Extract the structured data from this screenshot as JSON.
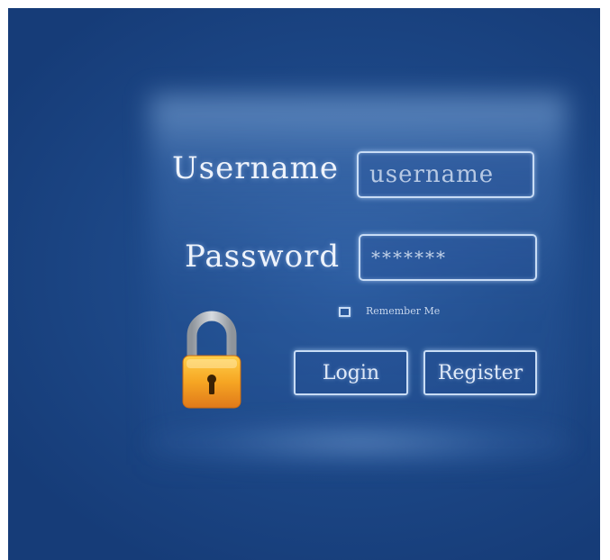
{
  "login": {
    "username_label": "Username",
    "username_value": "username",
    "password_label": "Password",
    "password_value": "*******",
    "remember_label": "Remember Me",
    "login_button": "Login",
    "register_button": "Register"
  },
  "icons": {
    "lock": "padlock-icon"
  },
  "colors": {
    "background": "#1e4a8a",
    "field_border": "#c8dcf5",
    "lock_body": "#f3a21c",
    "lock_shackle": "#a8adb3"
  }
}
